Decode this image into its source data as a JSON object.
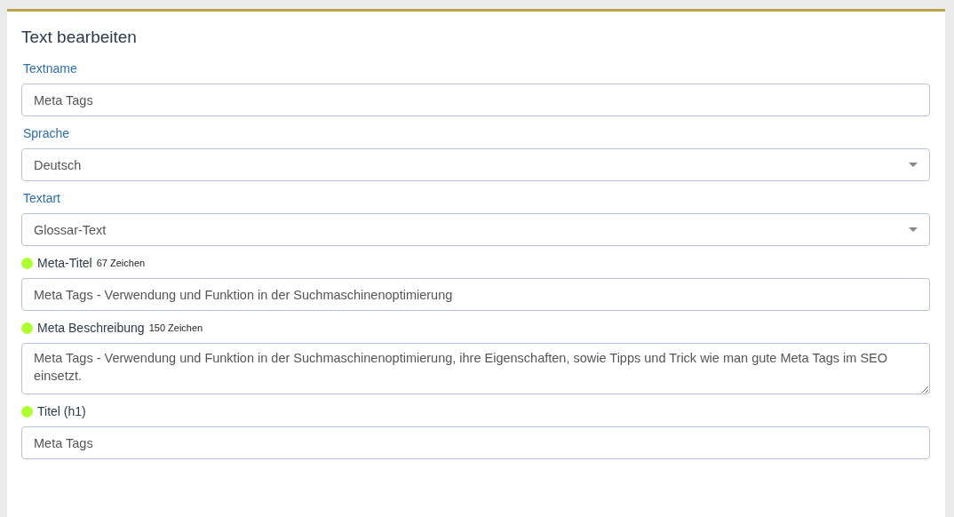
{
  "panel": {
    "title": "Text bearbeiten"
  },
  "fields": [
    {
      "kind": "text",
      "label": "Textname",
      "value": "Meta Tags"
    },
    {
      "kind": "select",
      "label": "Sprache",
      "value": "Deutsch"
    },
    {
      "kind": "select",
      "label": "Textart",
      "value": "Glossar-Text"
    },
    {
      "kind": "text",
      "label": "Meta-Titel",
      "count": "67 Zeichen",
      "color": "#adff2f",
      "value": "Meta Tags - Verwendung und Funktion in der Suchmaschinenoptimierung"
    },
    {
      "kind": "textarea",
      "label": "Meta Beschreibung",
      "count": "150 Zeichen",
      "color": "#adff2f",
      "value": "Meta Tags - Verwendung und Funktion in der Suchmaschinenoptimierung, ihre Eigenschaften, sowie Tipps und Trick wie man gute Meta Tags im SEO einsetzt."
    },
    {
      "kind": "text",
      "label": "Titel (h1)",
      "color": "#adff2f",
      "value": "Meta Tags"
    }
  ]
}
